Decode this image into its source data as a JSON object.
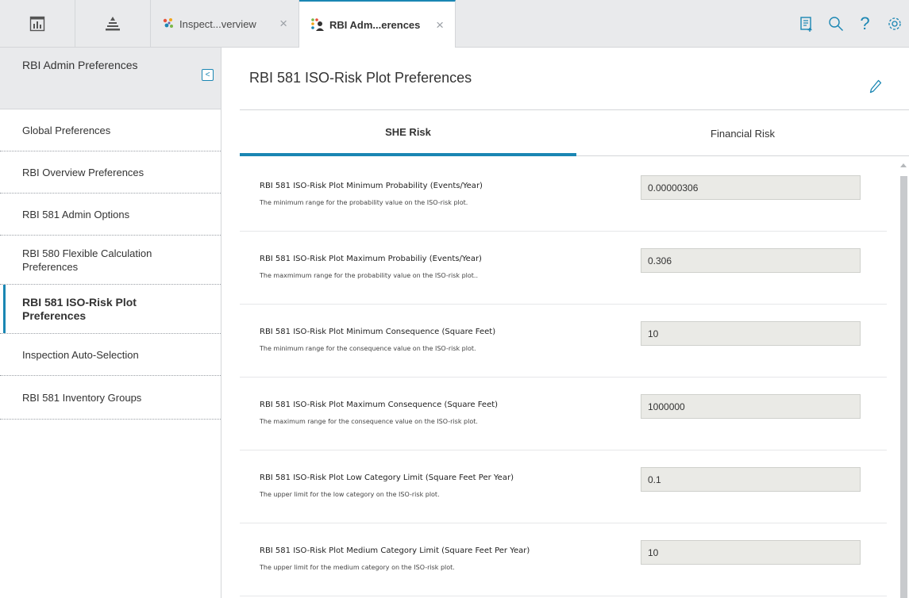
{
  "topbar": {
    "tabs": [
      {
        "label": "Inspect...verview",
        "active": false,
        "icon": "inspection-overview-icon"
      },
      {
        "label": "RBI Adm...erences",
        "active": true,
        "icon": "rbi-admin-icon"
      }
    ],
    "close_glyph": "×",
    "help_glyph": "?",
    "left_icons": [
      "dashboard-icon",
      "asset-hierarchy-icon"
    ],
    "right_icons": [
      "new-record-icon",
      "search-icon",
      "help-icon",
      "settings-icon"
    ]
  },
  "sidebar": {
    "title": "RBI Admin Preferences",
    "collapse_glyph": "<",
    "items": [
      {
        "label": "Global Preferences",
        "active": false
      },
      {
        "label": "RBI Overview Preferences",
        "active": false
      },
      {
        "label": "RBI 581 Admin Options",
        "active": false
      },
      {
        "label": "RBI 580 Flexible Calculation Preferences",
        "active": false
      },
      {
        "label": "RBI 581 ISO-Risk Plot Preferences",
        "active": true
      },
      {
        "label": "Inspection Auto-Selection",
        "active": false
      },
      {
        "label": "RBI 581 Inventory Groups",
        "active": false
      }
    ]
  },
  "main": {
    "title": "RBI 581 ISO-Risk Plot Preferences",
    "tabs": [
      {
        "label": "SHE Risk",
        "active": true
      },
      {
        "label": "Financial Risk",
        "active": false
      }
    ],
    "rows": [
      {
        "label": "RBI 581 ISO-Risk Plot Minimum Probability (Events/Year)",
        "description": "The minimum range for the probability value on the ISO-risk plot.",
        "value": "0.00000306"
      },
      {
        "label": "RBI 581 ISO-Risk Plot Maximum Probabiliy (Events/Year)",
        "description": "The maxmimum range for the probability value on the ISO-risk plot..",
        "value": "0.306"
      },
      {
        "label": "RBI 581 ISO-Risk Plot Minimum Consequence (Square Feet)",
        "description": "The minimum range for the consequence value on the ISO-risk plot.",
        "value": "10"
      },
      {
        "label": "RBI 581 ISO-Risk Plot Maximum Consequence (Square Feet)",
        "description": "The maximum range for the consequence value on the ISO-risk plot.",
        "value": "1000000"
      },
      {
        "label": "RBI 581 ISO-Risk Plot Low Category Limit (Square Feet Per Year)",
        "description": "The upper limit for the low category on the ISO-risk plot.",
        "value": "0.1"
      },
      {
        "label": "RBI 581 ISO-Risk Plot Medium Category Limit (Square Feet Per Year)",
        "description": "The upper limit for the medium category on the ISO-risk plot.",
        "value": "10"
      }
    ]
  },
  "colors": {
    "accent": "#1a86b3",
    "topbar_bg": "#e9eaec",
    "input_bg": "#eaeae6"
  }
}
